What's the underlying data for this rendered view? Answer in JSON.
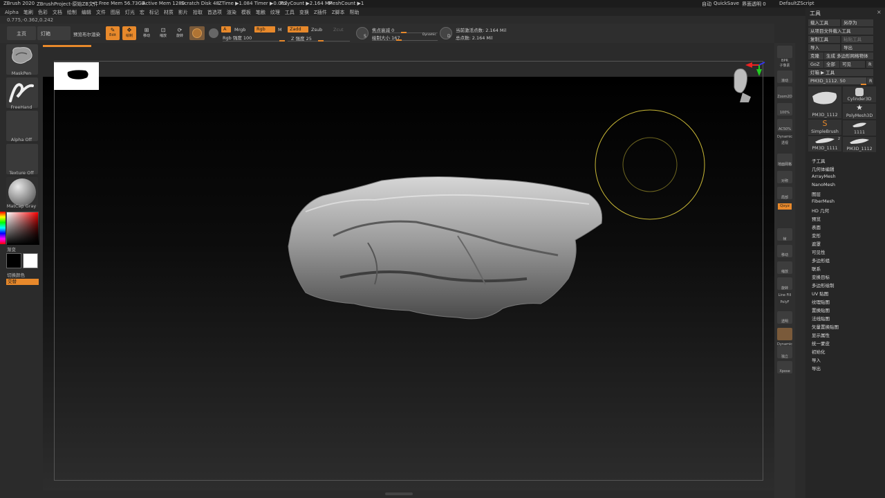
{
  "titlebar": {
    "app": "ZBrush 2020",
    "project": "ZBrushProject-原始ZB文件",
    "dots": "•",
    "free_mem": "Free Mem 56.73GB",
    "active_mem": "Active Mem 1280",
    "scratch": "Scratch Disk 48",
    "ztime": "ZTime ▶1.084 Timer ▶0.002",
    "polycount": "PolyCount ▶2.164 MP",
    "meshcount": "MeshCount ▶1",
    "right_a": "自动",
    "quicksave": "QuickSave",
    "transparency": "界面透明 0",
    "default_zscript": "DefaultZScript"
  },
  "menu": [
    "Alpha",
    "笔刷",
    "色彩",
    "文档",
    "绘制",
    "编辑",
    "文件",
    "图层",
    "灯光",
    "宏",
    "标记",
    "材质",
    "影片",
    "拾取",
    "首选项",
    "渲染",
    "模板",
    "笔触",
    "纹理",
    "工具",
    "变换",
    "Z插件",
    "Z脚本",
    "帮助"
  ],
  "coords": "0.775,-0.362,0.242",
  "toolbar": {
    "home": "主页",
    "lightbox": "灯箱",
    "preview_bool": "预览布尔渲染",
    "edit": "Edit",
    "draw": "绘制",
    "move": "移动",
    "scale": "缩放",
    "rotate": "旋转",
    "a_label": "A",
    "mrgb": "Mrgb",
    "rgb": "Rgb",
    "m": "M",
    "rgb_intensity": "Rgb 强度 100",
    "zadd": "Zadd",
    "zsub": "Zsub",
    "zcut": "Zcut",
    "z_intensity": "Z 强度 25",
    "focal_shift": "焦点衰减 0",
    "draw_size": "绘制大小 167",
    "dynamic": "Dynamic",
    "active_points": "当前激活点数: 2.164 Mil",
    "total_points": "总点数: 2.164 Mil",
    "s_label": "S",
    "d_label": "D"
  },
  "leftpanel": {
    "brush": "MaskPen",
    "stroke": "FreeHand",
    "alpha": "Alpha Off",
    "texture": "Texture Off",
    "material": "MatCap Gray",
    "gradient": "渐变",
    "switch_color": "切换颜色",
    "alternate": "交替"
  },
  "vtoolbar": [
    {
      "label": "BPR"
    },
    {
      "label": "子像素"
    },
    {
      "label": "滚动"
    },
    {
      "label": "Zoom2D"
    },
    {
      "label": "100%"
    },
    {
      "label": "AC50%"
    },
    {
      "label": "Dynamic"
    },
    {
      "label": "透视"
    },
    {
      "label": "地面网格"
    },
    {
      "label": "对称"
    },
    {
      "label": "局部"
    },
    {
      "label": "Qxyz"
    },
    {
      "label": "帧"
    },
    {
      "label": "移动"
    },
    {
      "label": "缩放"
    },
    {
      "label": "旋转"
    },
    {
      "label": "Line Fill"
    },
    {
      "label": "PolyF"
    },
    {
      "label": "透明"
    },
    {
      "label": "Dynamic"
    },
    {
      "label": "独立"
    },
    {
      "label": "Xpose"
    }
  ],
  "rightpanel": {
    "title": "工具",
    "load_tool": "载入工具",
    "save_as": "另存为",
    "load_from_project": "从项目文件载入工具",
    "copy_tool": "复制工具",
    "paste_tool": "粘贴工具",
    "import": "导入",
    "export": "导出",
    "clone": "克隆",
    "make_polymesh": "生成 多边形网格物体",
    "goz": "GoZ",
    "all": "全部",
    "visible": "可见",
    "r": "R",
    "lightbox_tools": "灯箱 ▶ 工具",
    "current_tool": "PM3D_1112. 50",
    "tools": [
      {
        "name": "PM3D_1112"
      },
      {
        "name": "Cylinder3D"
      },
      {
        "name": "SimpleBrush"
      },
      {
        "name": "PolyMesh3D"
      },
      {
        "name": "PM3D_1111"
      },
      {
        "name": "1111"
      },
      {
        "name": "PM3D_1112"
      }
    ],
    "tool_badge": "2",
    "subpalettes": [
      "子工具",
      "几何体编辑",
      "ArrayMesh",
      "NanoMesh",
      "图层",
      "FiberMesh",
      "HD 几何",
      "预览",
      "表面",
      "变形",
      "遮罩",
      "可见性",
      "多边形组",
      "联系",
      "变换目标",
      "多边形绘制",
      "UV 贴图",
      "纹理贴图",
      "置换贴图",
      "法线贴图",
      "矢量置换贴图",
      "显示属性",
      "统一蒙皮",
      "初始化",
      "导入",
      "导出"
    ]
  }
}
